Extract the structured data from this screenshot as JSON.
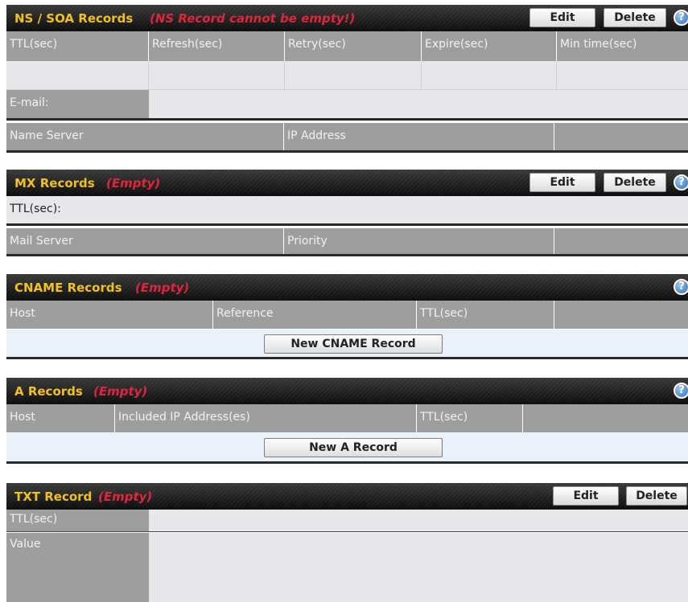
{
  "ns_soa": {
    "title": "NS / SOA Records",
    "note": "(NS Record cannot be empty!)",
    "edit": "Edit",
    "delete": "Delete",
    "help": "?",
    "columns": [
      "TTL(sec)",
      "Refresh(sec)",
      "Retry(sec)",
      "Expire(sec)",
      "Min time(sec)"
    ],
    "email_label": "E-mail:",
    "ns_columns": [
      "Name Server",
      "IP Address"
    ]
  },
  "mx": {
    "title": "MX Records",
    "note": "(Empty)",
    "edit": "Edit",
    "delete": "Delete",
    "help": "?",
    "ttl_label": "TTL(sec):",
    "columns": [
      "Mail Server",
      "Priority"
    ]
  },
  "cname": {
    "title": "CNAME Records",
    "note": "(Empty)",
    "help": "?",
    "columns": [
      "Host",
      "Reference",
      "TTL(sec)"
    ],
    "new_button": "New CNAME Record"
  },
  "a": {
    "title": "A Records",
    "note": "(Empty)",
    "help": "?",
    "columns": [
      "Host",
      "Included IP Address(es)",
      "TTL(sec)"
    ],
    "new_button": "New A Record"
  },
  "txt": {
    "title": "TXT Record",
    "note": "(Empty)",
    "edit": "Edit",
    "delete": "Delete",
    "ttl_label": "TTL(sec)",
    "value_label": "Value"
  },
  "colors": {
    "title": "#f3c11a",
    "note": "#e0263b",
    "label_bg": "#9e9e9e",
    "value_bg": "#e7e7ec",
    "action_bg": "#e9f1fb"
  }
}
